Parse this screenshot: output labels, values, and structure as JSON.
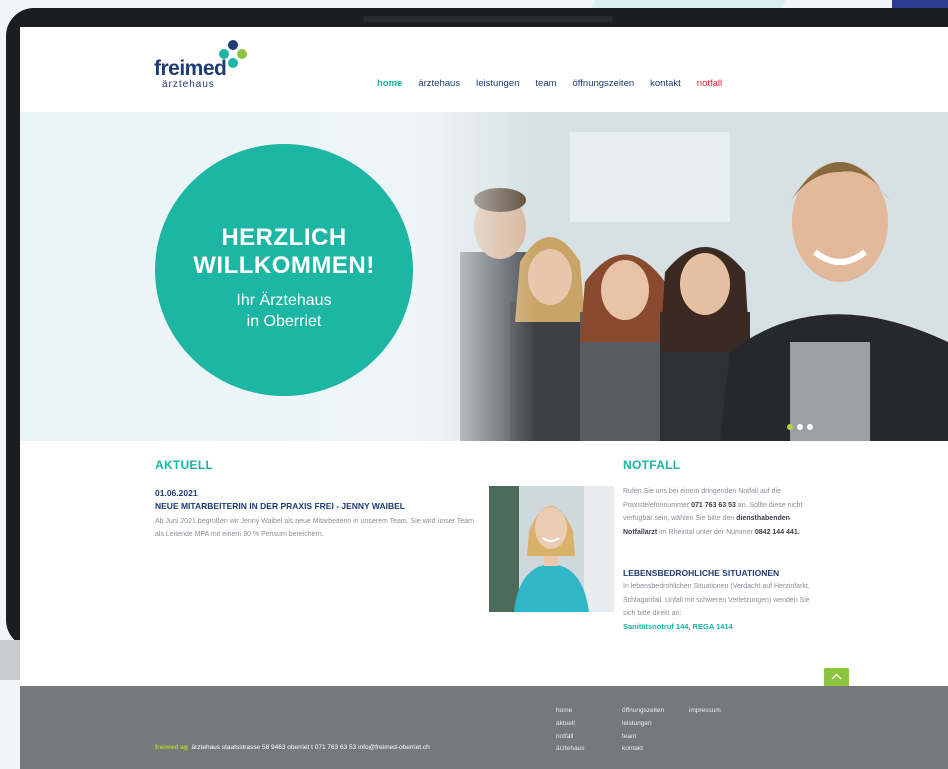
{
  "logo": {
    "word": "freimed",
    "sub": "ärztehaus"
  },
  "nav": [
    {
      "label": "home",
      "state": "active"
    },
    {
      "label": "ärztehaus",
      "state": ""
    },
    {
      "label": "leistungen",
      "state": ""
    },
    {
      "label": "team",
      "state": ""
    },
    {
      "label": "öffnungszeiten",
      "state": ""
    },
    {
      "label": "kontakt",
      "state": ""
    },
    {
      "label": "notfall",
      "state": "emergency"
    }
  ],
  "hero": {
    "title_line1": "HERZLICH",
    "title_line2": "WILLKOMMEN!",
    "sub_line1": "Ihr Ärztehaus",
    "sub_line2": "in Oberriet",
    "slides": 3,
    "active_slide": 1
  },
  "news": {
    "heading": "AKTUELL",
    "date": "01.06.2021",
    "title": "NEUE MITARBEITERIN IN DER PRAXIS FREI - JENNY WAIBEL",
    "body": "Ab Juni 2021 begrüßen wir Jenny Waibel als neue Mitarbeiterin in unserem Team. Sie wird unser Team als Leitende MPA mit einem 90 % Pensum bereichern."
  },
  "emergency": {
    "heading": "NOTFALL",
    "p1_a": "Rufen Sie uns bei einem dringenden Notfall auf die Praxistelefonnummer ",
    "p1_phone": "071 763 63 53",
    "p1_b": " an. Sollte diese nicht verfügbar sein, wählen Sie bitte den ",
    "p1_doctor": "diensthabenden Notfallarzt",
    "p1_c": " im Rheintal unter der Nummer ",
    "p1_number": "0842 144 441.",
    "sub_heading": "LEBENSBEDROHLICHE SITUATIONEN",
    "p2": "In lebensbedrohlichen Situationen (Verdacht auf Herzinfarkt, Schlaganfall, Unfall mit schweren Verletzungen) wenden Sie sich bitte direkt an:",
    "call": "Sanitätsnotruf 144, REGA 1414"
  },
  "footer": {
    "brand": "freimed ag",
    "address": "ärztehaus   staatsstrasse 58   9463 oberriet   t 071 763 63 53   info@freimed-oberriet.ch",
    "col1": [
      "home",
      "aktuell",
      "notfall",
      "ärztehaus"
    ],
    "col2": [
      "öffnungszeiten",
      "leistungen",
      "team",
      "kontakt"
    ],
    "col3": [
      "impressum"
    ]
  },
  "colors": {
    "accent": "#1db5a4",
    "brand_blue": "#1f3b73",
    "lime": "#b5d334",
    "emergency": "#e2242f",
    "footer": "#76787a"
  },
  "icons": {
    "to_top": "chevron-up-icon"
  }
}
